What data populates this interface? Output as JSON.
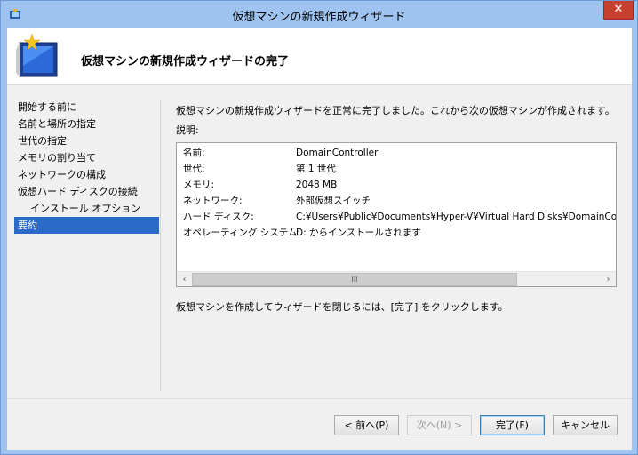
{
  "window": {
    "title": "仮想マシンの新規作成ウィザード",
    "close_label": "✕"
  },
  "header": {
    "title": "仮想マシンの新規作成ウィザードの完了"
  },
  "nav": {
    "items": [
      {
        "label": "開始する前に"
      },
      {
        "label": "名前と場所の指定"
      },
      {
        "label": "世代の指定"
      },
      {
        "label": "メモリの割り当て"
      },
      {
        "label": "ネットワークの構成"
      },
      {
        "label": "仮想ハード ディスクの接続"
      },
      {
        "label": "インストール オプション"
      },
      {
        "label": "要約"
      }
    ],
    "active_index": 7
  },
  "main": {
    "intro": "仮想マシンの新規作成ウィザードを正常に完了しました。これから次の仮想マシンが作成されます。",
    "description_label": "説明:",
    "summary": [
      {
        "key": "名前:",
        "value": "DomainController"
      },
      {
        "key": "世代:",
        "value": "第 1 世代"
      },
      {
        "key": "メモリ:",
        "value": "2048 MB"
      },
      {
        "key": "ネットワーク:",
        "value": "外部仮想スイッチ"
      },
      {
        "key": "ハード ディスク:",
        "value": "C:¥Users¥Public¥Documents¥Hyper-V¥Virtual Hard Disks¥DomainController.vhdx"
      },
      {
        "key": "オペレーティング システム:",
        "value": "D: からインストールされます"
      }
    ],
    "scroll_thumb_label": "III",
    "finish_note": "仮想マシンを作成してウィザードを閉じるには、[完了] をクリックします。"
  },
  "buttons": {
    "previous": "< 前へ(P)",
    "next": "次へ(N) >",
    "finish": "完了(F)",
    "cancel": "キャンセル"
  },
  "colors": {
    "title_bar": "#9ec3f0",
    "nav_selected": "#2a6ac8",
    "close_button": "#c7402f"
  }
}
